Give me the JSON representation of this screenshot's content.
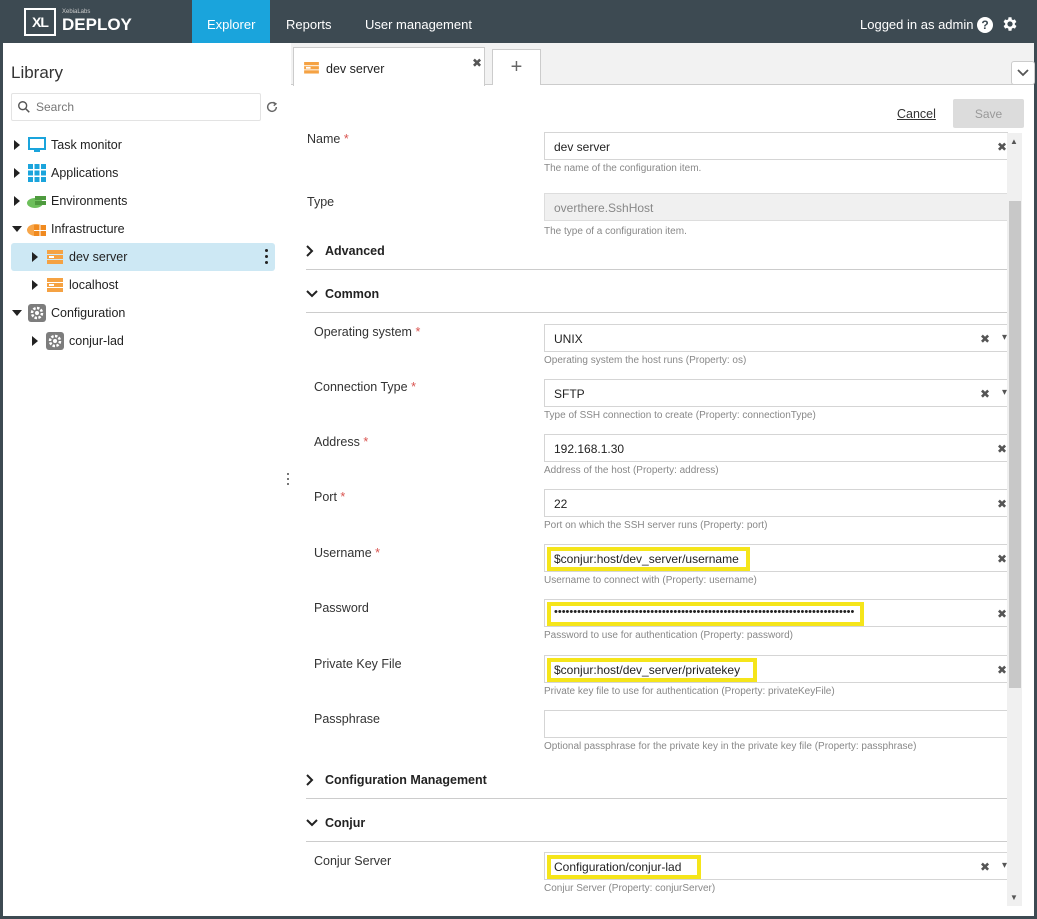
{
  "brand": {
    "sub": "XebiaLabs",
    "main": "DEPLOY",
    "mark": "XL"
  },
  "nav": {
    "explorer": "Explorer",
    "reports": "Reports",
    "users": "User management"
  },
  "user": {
    "logged_in": "Logged in as admin",
    "help": "?"
  },
  "library": {
    "title": "Library",
    "search_placeholder": "Search",
    "tree": [
      {
        "label": "Task monitor",
        "icon": "monitor-icon"
      },
      {
        "label": "Applications",
        "icon": "grid-icon"
      },
      {
        "label": "Environments",
        "icon": "environment-icon"
      },
      {
        "label": "Infrastructure",
        "icon": "infrastructure-icon"
      },
      {
        "label": "dev server",
        "icon": "server-icon",
        "selected": true
      },
      {
        "label": "localhost",
        "icon": "server-icon"
      },
      {
        "label": "Configuration",
        "icon": "config-gear-icon"
      },
      {
        "label": "conjur-lad",
        "icon": "config-gear-icon"
      }
    ]
  },
  "tabs": {
    "active": "dev server",
    "close": "✖",
    "add": "+"
  },
  "actions": {
    "cancel": "Cancel",
    "save": "Save"
  },
  "form": {
    "name": {
      "label": "Name",
      "value": "dev server",
      "hint": "The name of the configuration item."
    },
    "type": {
      "label": "Type",
      "value": "overthere.SshHost",
      "hint": "The type of a configuration item."
    },
    "sections": {
      "advanced": "Advanced",
      "common": "Common",
      "cm": "Configuration Management",
      "conjur": "Conjur"
    },
    "os": {
      "label": "Operating system",
      "value": "UNIX",
      "hint": "Operating system the host runs (Property: os)"
    },
    "conn": {
      "label": "Connection Type",
      "value": "SFTP",
      "hint": "Type of SSH connection to create (Property: connectionType)"
    },
    "address": {
      "label": "Address",
      "value": "192.168.1.30",
      "hint": "Address of the host (Property: address)"
    },
    "port": {
      "label": "Port",
      "value": "22",
      "hint": "Port on which the SSH server runs (Property: port)"
    },
    "username": {
      "label": "Username",
      "value": "$conjur:host/dev_server/username",
      "hint": "Username to connect with (Property: username)"
    },
    "password": {
      "label": "Password",
      "value": "••••••••••••••••••••••••••••••••••••••••••••••••••••••••••••••••••••••••••••••",
      "hint": "Password to use for authentication (Property: password)"
    },
    "pkey": {
      "label": "Private Key File",
      "value": "$conjur:host/dev_server/privatekey",
      "hint": "Private key file to use for authentication (Property: privateKeyFile)"
    },
    "passphrase": {
      "label": "Passphrase",
      "value": "",
      "hint": "Optional passphrase for the private key in the private key file (Property: passphrase)"
    },
    "conjur_server": {
      "label": "Conjur Server",
      "value": "Configuration/conjur-lad",
      "hint": "Conjur Server (Property: conjurServer)"
    }
  },
  "colors": {
    "topbar": "#3d4a52",
    "accent": "#1aa4dc",
    "highlight": "#f5e51a",
    "selected_row": "#cde8f4"
  }
}
